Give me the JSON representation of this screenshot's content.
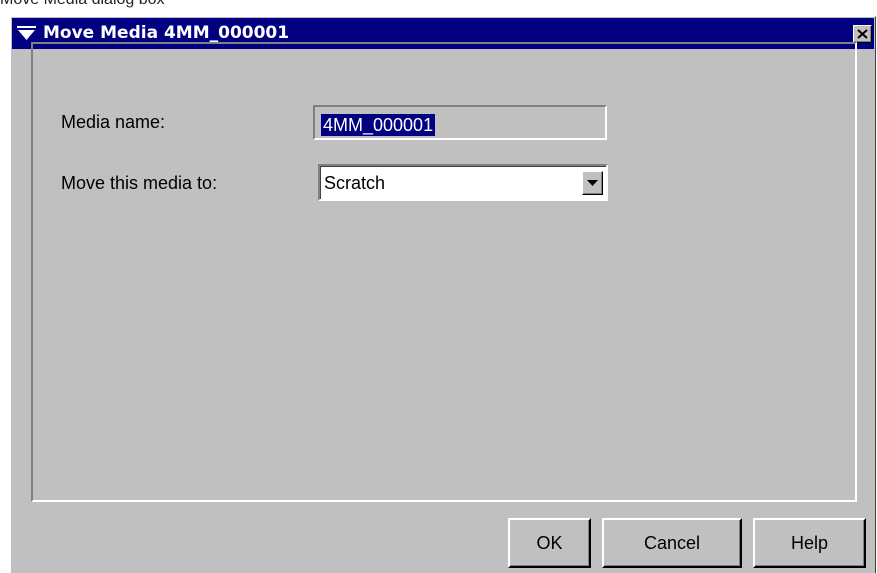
{
  "window": {
    "caption_above": "Move Media dialog box",
    "title": "Move Media 4MM_000001"
  },
  "form": {
    "media_name_label": "Media name:",
    "media_name_value": "4MM_000001",
    "move_to_label": "Move this media to:",
    "move_to_selected": "Scratch"
  },
  "buttons": {
    "ok": "OK",
    "cancel": "Cancel",
    "help": "Help"
  },
  "icons": {
    "window_menu": "window-menu-icon",
    "close": "close-icon",
    "dropdown": "chevron-down-icon"
  },
  "colors": {
    "titlebar": "#000080",
    "dialog_background": "#c0c0c0",
    "selection": "#000080"
  }
}
